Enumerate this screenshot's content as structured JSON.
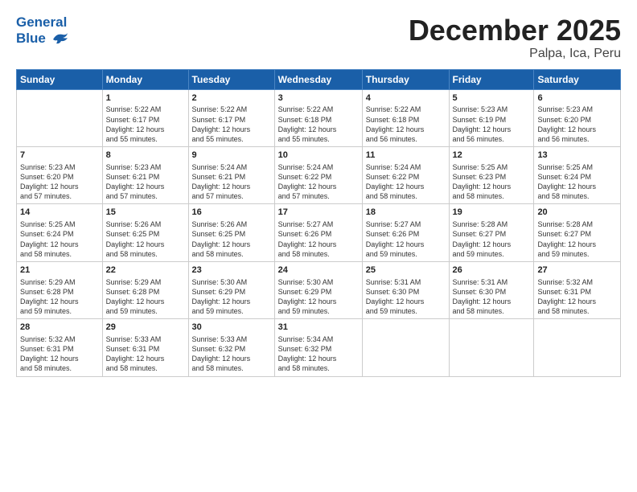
{
  "logo": {
    "text1": "General",
    "text2": "Blue"
  },
  "title": "December 2025",
  "subtitle": "Palpa, Ica, Peru",
  "days_of_week": [
    "Sunday",
    "Monday",
    "Tuesday",
    "Wednesday",
    "Thursday",
    "Friday",
    "Saturday"
  ],
  "weeks": [
    [
      {
        "day": "",
        "info": ""
      },
      {
        "day": "1",
        "info": "Sunrise: 5:22 AM\nSunset: 6:17 PM\nDaylight: 12 hours\nand 55 minutes."
      },
      {
        "day": "2",
        "info": "Sunrise: 5:22 AM\nSunset: 6:17 PM\nDaylight: 12 hours\nand 55 minutes."
      },
      {
        "day": "3",
        "info": "Sunrise: 5:22 AM\nSunset: 6:18 PM\nDaylight: 12 hours\nand 55 minutes."
      },
      {
        "day": "4",
        "info": "Sunrise: 5:22 AM\nSunset: 6:18 PM\nDaylight: 12 hours\nand 56 minutes."
      },
      {
        "day": "5",
        "info": "Sunrise: 5:23 AM\nSunset: 6:19 PM\nDaylight: 12 hours\nand 56 minutes."
      },
      {
        "day": "6",
        "info": "Sunrise: 5:23 AM\nSunset: 6:20 PM\nDaylight: 12 hours\nand 56 minutes."
      }
    ],
    [
      {
        "day": "7",
        "info": "Sunrise: 5:23 AM\nSunset: 6:20 PM\nDaylight: 12 hours\nand 57 minutes."
      },
      {
        "day": "8",
        "info": "Sunrise: 5:23 AM\nSunset: 6:21 PM\nDaylight: 12 hours\nand 57 minutes."
      },
      {
        "day": "9",
        "info": "Sunrise: 5:24 AM\nSunset: 6:21 PM\nDaylight: 12 hours\nand 57 minutes."
      },
      {
        "day": "10",
        "info": "Sunrise: 5:24 AM\nSunset: 6:22 PM\nDaylight: 12 hours\nand 57 minutes."
      },
      {
        "day": "11",
        "info": "Sunrise: 5:24 AM\nSunset: 6:22 PM\nDaylight: 12 hours\nand 58 minutes."
      },
      {
        "day": "12",
        "info": "Sunrise: 5:25 AM\nSunset: 6:23 PM\nDaylight: 12 hours\nand 58 minutes."
      },
      {
        "day": "13",
        "info": "Sunrise: 5:25 AM\nSunset: 6:24 PM\nDaylight: 12 hours\nand 58 minutes."
      }
    ],
    [
      {
        "day": "14",
        "info": "Sunrise: 5:25 AM\nSunset: 6:24 PM\nDaylight: 12 hours\nand 58 minutes."
      },
      {
        "day": "15",
        "info": "Sunrise: 5:26 AM\nSunset: 6:25 PM\nDaylight: 12 hours\nand 58 minutes."
      },
      {
        "day": "16",
        "info": "Sunrise: 5:26 AM\nSunset: 6:25 PM\nDaylight: 12 hours\nand 58 minutes."
      },
      {
        "day": "17",
        "info": "Sunrise: 5:27 AM\nSunset: 6:26 PM\nDaylight: 12 hours\nand 58 minutes."
      },
      {
        "day": "18",
        "info": "Sunrise: 5:27 AM\nSunset: 6:26 PM\nDaylight: 12 hours\nand 59 minutes."
      },
      {
        "day": "19",
        "info": "Sunrise: 5:28 AM\nSunset: 6:27 PM\nDaylight: 12 hours\nand 59 minutes."
      },
      {
        "day": "20",
        "info": "Sunrise: 5:28 AM\nSunset: 6:27 PM\nDaylight: 12 hours\nand 59 minutes."
      }
    ],
    [
      {
        "day": "21",
        "info": "Sunrise: 5:29 AM\nSunset: 6:28 PM\nDaylight: 12 hours\nand 59 minutes."
      },
      {
        "day": "22",
        "info": "Sunrise: 5:29 AM\nSunset: 6:28 PM\nDaylight: 12 hours\nand 59 minutes."
      },
      {
        "day": "23",
        "info": "Sunrise: 5:30 AM\nSunset: 6:29 PM\nDaylight: 12 hours\nand 59 minutes."
      },
      {
        "day": "24",
        "info": "Sunrise: 5:30 AM\nSunset: 6:29 PM\nDaylight: 12 hours\nand 59 minutes."
      },
      {
        "day": "25",
        "info": "Sunrise: 5:31 AM\nSunset: 6:30 PM\nDaylight: 12 hours\nand 59 minutes."
      },
      {
        "day": "26",
        "info": "Sunrise: 5:31 AM\nSunset: 6:30 PM\nDaylight: 12 hours\nand 58 minutes."
      },
      {
        "day": "27",
        "info": "Sunrise: 5:32 AM\nSunset: 6:31 PM\nDaylight: 12 hours\nand 58 minutes."
      }
    ],
    [
      {
        "day": "28",
        "info": "Sunrise: 5:32 AM\nSunset: 6:31 PM\nDaylight: 12 hours\nand 58 minutes."
      },
      {
        "day": "29",
        "info": "Sunrise: 5:33 AM\nSunset: 6:31 PM\nDaylight: 12 hours\nand 58 minutes."
      },
      {
        "day": "30",
        "info": "Sunrise: 5:33 AM\nSunset: 6:32 PM\nDaylight: 12 hours\nand 58 minutes."
      },
      {
        "day": "31",
        "info": "Sunrise: 5:34 AM\nSunset: 6:32 PM\nDaylight: 12 hours\nand 58 minutes."
      },
      {
        "day": "",
        "info": ""
      },
      {
        "day": "",
        "info": ""
      },
      {
        "day": "",
        "info": ""
      }
    ]
  ]
}
